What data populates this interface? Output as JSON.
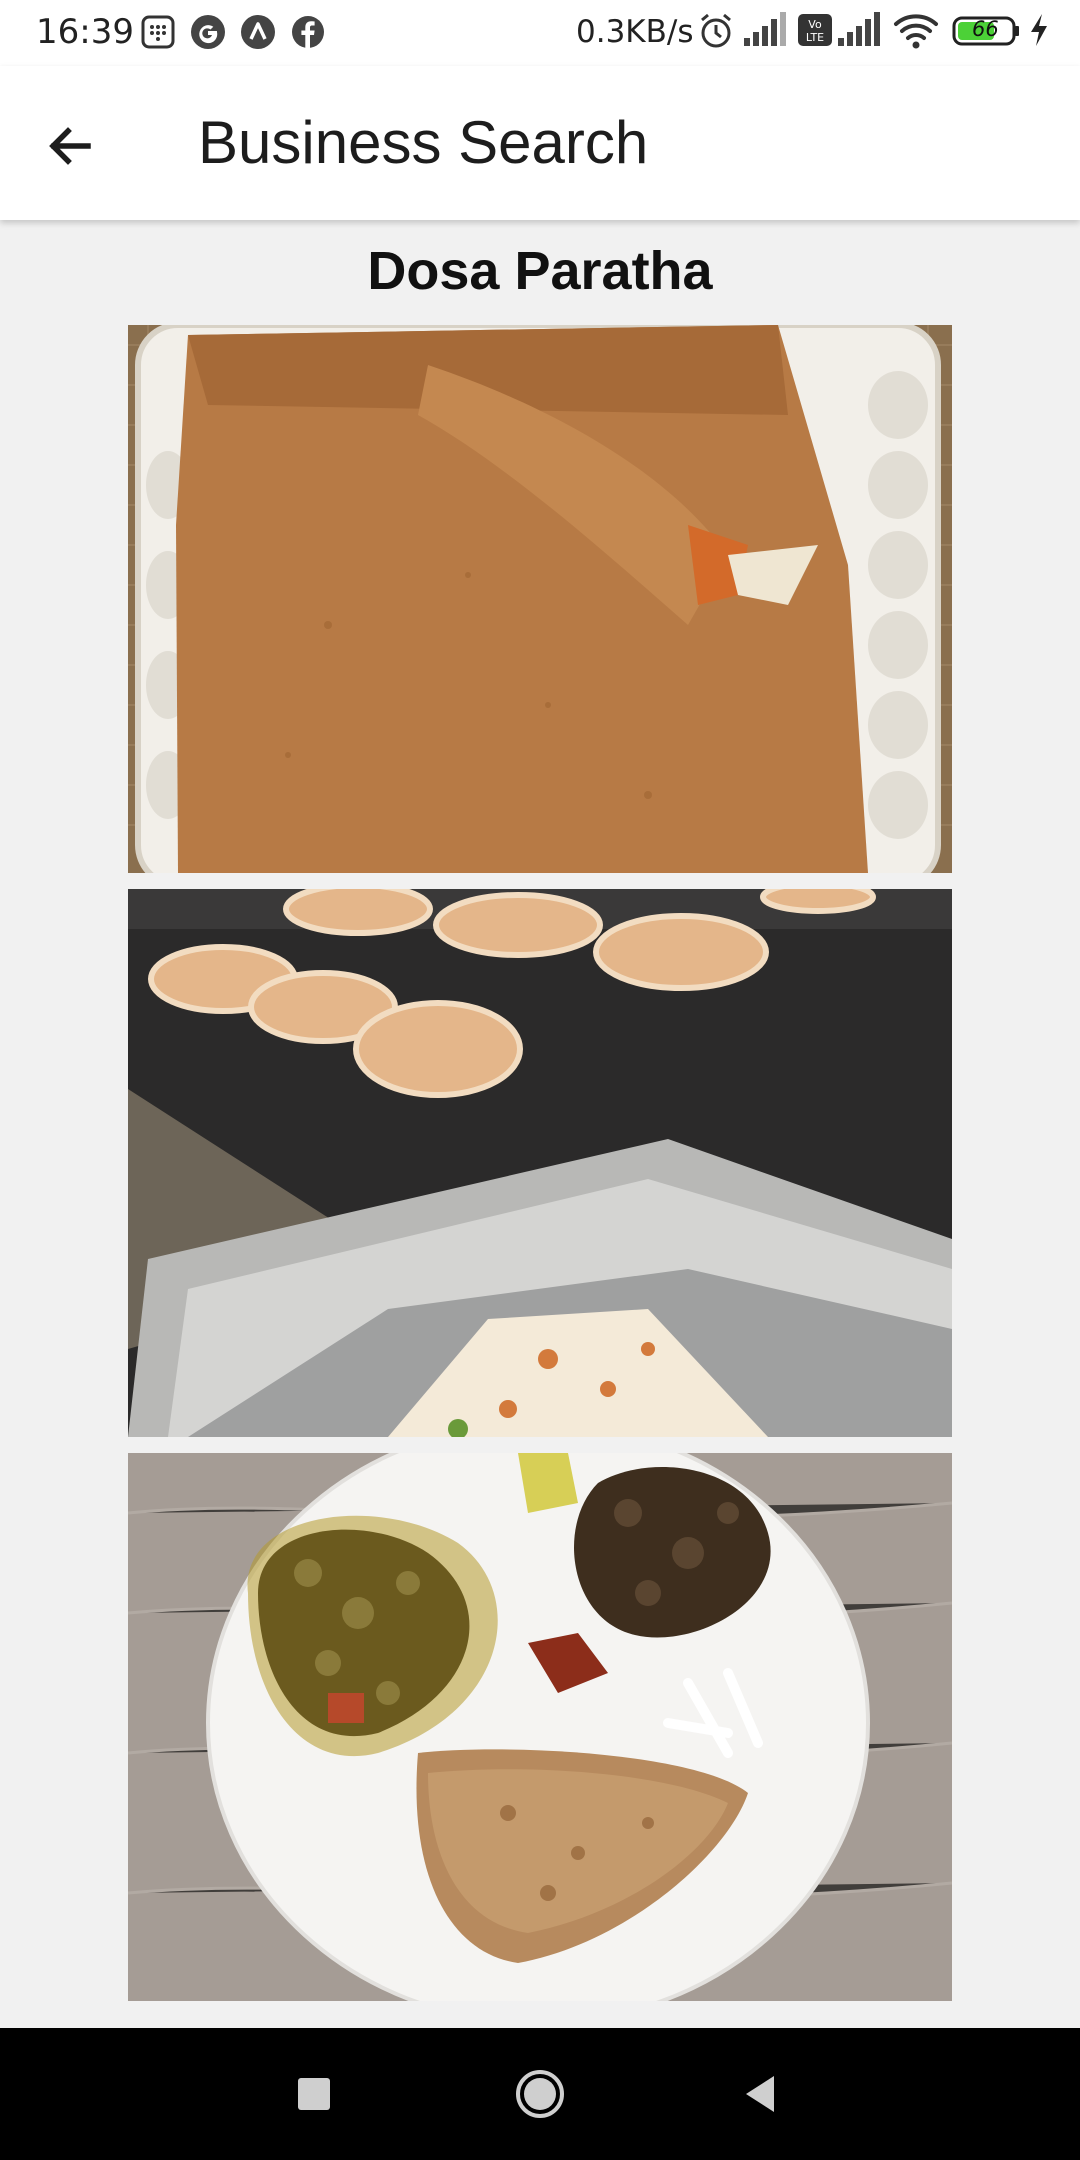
{
  "status_bar": {
    "time": "16:39",
    "network_speed": "0.3KB/s",
    "battery": "66",
    "icons": [
      "calendar-icon",
      "google-icon",
      "arrow-up-icon",
      "facebook-icon",
      "alarm-icon",
      "signal-icon",
      "volte-icon",
      "signal-icon",
      "wifi-icon",
      "battery-icon",
      "charging-icon"
    ]
  },
  "app_bar": {
    "back_icon": "arrow-left-icon",
    "title": "Business Search"
  },
  "business": {
    "name": "Dosa Paratha",
    "photos": [
      {
        "subject": "dosa-in-tray"
      },
      {
        "subject": "uttapam-on-griddle"
      },
      {
        "subject": "paratha-plate-with-curry"
      }
    ]
  },
  "nav_bar": {
    "buttons": [
      "square-icon",
      "circle-home-icon",
      "triangle-back-icon"
    ]
  },
  "colors": {
    "background": "#f1f1f1",
    "app_bar": "#ffffff",
    "nav_bar": "#000000",
    "battery_green": "#4cd137"
  }
}
